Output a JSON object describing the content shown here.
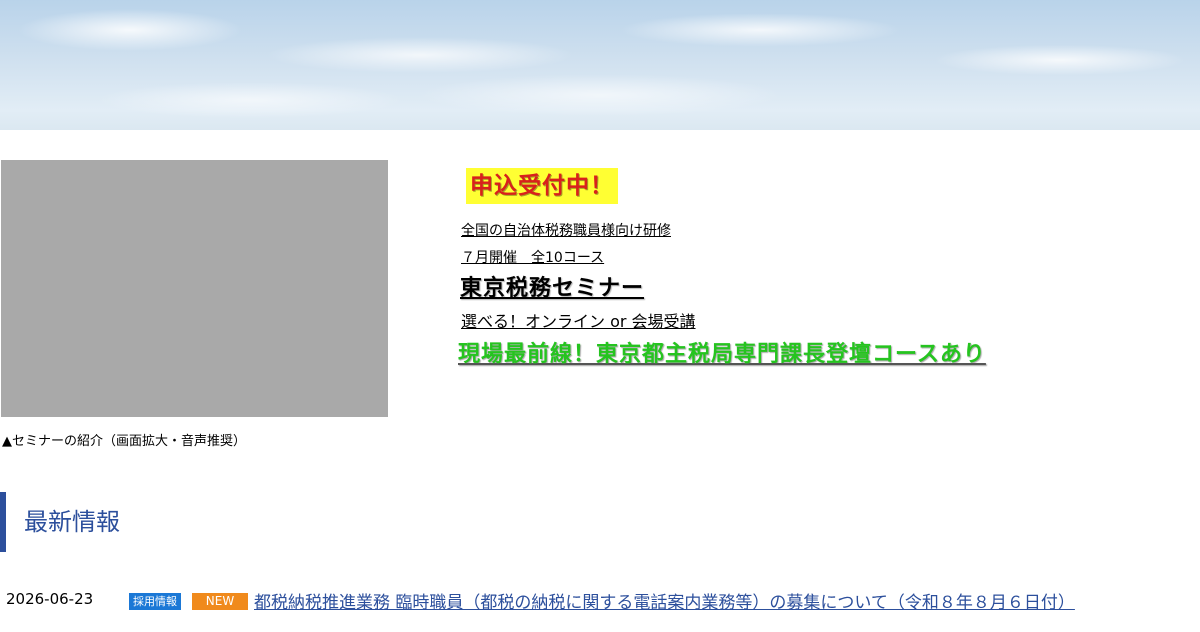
{
  "promo": {
    "badge": "申込受付中！",
    "target": "全国の自治体税務職員様向け研修",
    "schedule": "７月開催　全10コース",
    "title": "東京税務セミナー",
    "format": "選べる！オンライン or 会場受講",
    "highlight": "現場最前線！東京都主税局専門課長登壇コースあり"
  },
  "video": {
    "caption": "▲セミナーの紹介（画面拡大・音声推奨）"
  },
  "news": {
    "heading": "最新情報",
    "items": [
      {
        "date": "2026-06-23",
        "category": "採用情報",
        "new_label": "NEW",
        "title": "都税納税推進業務 臨時職員（都税の納税に関する電話案内業務等）の募集について（令和８年８月６日付）"
      }
    ]
  },
  "colors": {
    "badge_bg": "#ffff33",
    "badge_text": "#d8211c",
    "highlight_green": "#25c41f",
    "accent_blue": "#2c4f9c",
    "category_tag": "#1b78d6",
    "new_tag": "#f08a1c",
    "video_placeholder": "#a9a9a9"
  }
}
